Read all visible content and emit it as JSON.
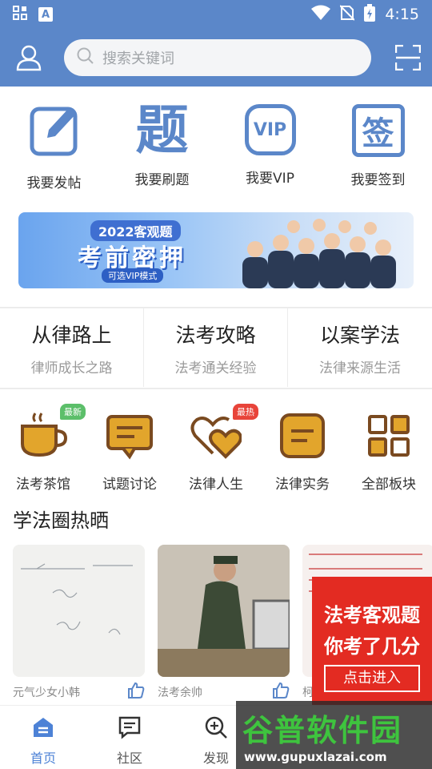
{
  "status_bar": {
    "time": "4:15",
    "app_icon_letter": "A"
  },
  "header": {
    "search_placeholder": "搜索关键词"
  },
  "quick_actions": [
    {
      "label": "我要发帖",
      "icon": "edit-icon"
    },
    {
      "label": "我要刷题",
      "icon": "question-char-icon",
      "glyph": "题"
    },
    {
      "label": "我要VIP",
      "icon": "vip-icon",
      "glyph": "VIP"
    },
    {
      "label": "我要签到",
      "icon": "checkin-icon",
      "glyph": "签"
    }
  ],
  "banner": {
    "year_title": "2022客观题",
    "main_title": "考前密押",
    "tag": "可选VIP模式"
  },
  "sections": [
    {
      "title": "从律路上",
      "subtitle": "律师成长之路"
    },
    {
      "title": "法考攻略",
      "subtitle": "法考通关经验"
    },
    {
      "title": "以案学法",
      "subtitle": "法律来源生活"
    }
  ],
  "boards": [
    {
      "label": "法考茶馆",
      "icon": "tea-cup-icon",
      "badge": "最新",
      "badge_color": "#5cbf6a"
    },
    {
      "label": "试题讨论",
      "icon": "discussion-icon",
      "badge": ""
    },
    {
      "label": "法律人生",
      "icon": "hearts-icon",
      "badge": "最热",
      "badge_color": "#e8443a"
    },
    {
      "label": "法律实务",
      "icon": "notes-icon",
      "badge": ""
    },
    {
      "label": "全部板块",
      "icon": "grid-icon",
      "badge": ""
    }
  ],
  "feed": {
    "title": "学法圈热晒",
    "cards": [
      {
        "author": "元气少女小韩"
      },
      {
        "author": "法考余帅"
      },
      {
        "author": "柯"
      }
    ]
  },
  "promo": {
    "line1": "法考客观题",
    "line2": "你考了几分",
    "button": "点击进入"
  },
  "tabbar": [
    {
      "label": "首页",
      "icon": "home-icon",
      "active": true
    },
    {
      "label": "社区",
      "icon": "community-icon",
      "active": false
    },
    {
      "label": "发现",
      "icon": "discover-icon",
      "active": false
    }
  ],
  "watermark": {
    "title": "谷普软件园",
    "url": "www.gupuxlazai.com"
  },
  "colors": {
    "primary": "#5b87c9",
    "gold": "#e2a52c",
    "brown": "#7a4a20",
    "promo_red": "#e32b22"
  }
}
